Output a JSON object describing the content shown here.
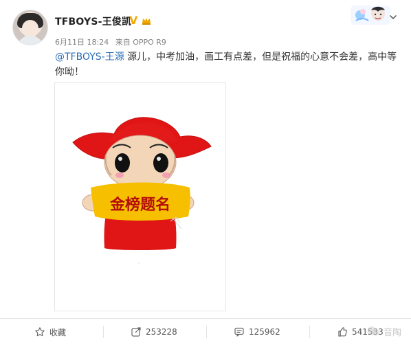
{
  "post": {
    "username": "TFBOYS-王俊凯",
    "meta": {
      "date": "6月11日 18:24",
      "source": "来自 OPPO R9"
    },
    "text": {
      "mention": "@TFBOYS-王源",
      "rest": " 源儿，中考加油，画工有点差，但是祝福的心意不会差，高中等你呦！"
    },
    "image": {
      "banner_text": "金榜题名"
    }
  },
  "actions": {
    "favorite_label": "收藏",
    "repost_count": "253228",
    "comment_count": "125962",
    "like_count": "541533"
  },
  "watermark": {
    "text": "音陶"
  },
  "colors": {
    "link": "#2b6cb3",
    "v_badge": "#f0a800",
    "hat_red": "#e01616",
    "banner_yellow": "#f6c000"
  },
  "icons": {
    "favorite": "star-icon",
    "repost": "share-icon",
    "comment": "comment-icon",
    "like": "thumbs-up-icon",
    "menu": "chevron-down-icon"
  }
}
